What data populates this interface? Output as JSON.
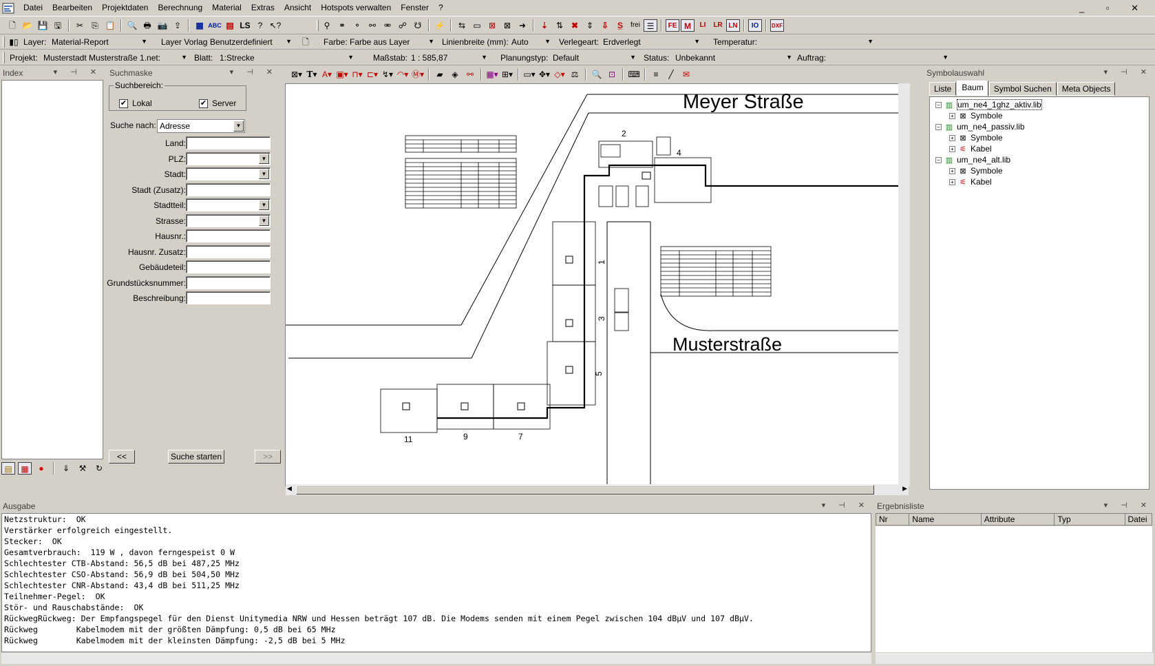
{
  "menu": [
    "Datei",
    "Bearbeiten",
    "Projektdaten",
    "Berechnung",
    "Material",
    "Extras",
    "Ansicht",
    "Hotspots verwalten",
    "Fenster",
    "?"
  ],
  "toolbar1": {
    "icons_left": [
      "new-icon",
      "open-icon",
      "save-icon",
      "save-all-icon",
      "cut-icon",
      "copy-icon",
      "paste-icon",
      "print-preview-icon",
      "print-icon",
      "camera-icon",
      "export-icon",
      "check-icon",
      "abc-icon",
      "check-network-icon",
      "ls-icon",
      "help-icon",
      "pointer-help-icon"
    ],
    "text_freq": "frei"
  },
  "toolbar2": {
    "layer_label": "Layer:",
    "layer_value": "Material-Report",
    "vorlage_label": "Layer Vorlage:",
    "vorlage_value": "Benutzerdefiniert",
    "farbe_label": "Farbe:",
    "farbe_value": "Farbe aus Layer",
    "linienbreite_label": "Linienbreite (mm):",
    "linienbreite_value": "Auto",
    "verlegeart_label": "Verlegeart:",
    "verlegeart_value": "Erdverlegt",
    "temperatur_label": "Temperatur:",
    "temperatur_value": ""
  },
  "toolbar3": {
    "projekt_label": "Projekt:",
    "projekt_value": "Musterstadt Musterstraße 1.net:",
    "blatt_label": "Blatt:",
    "blatt_value": "1:Strecke",
    "massstab_label": "Maßstab:",
    "massstab_value": "1 : 585,87",
    "planungstyp_label": "Planungstyp:",
    "planungstyp_value": "Default",
    "status_label": "Status:",
    "status_value": "Unbekannt",
    "auftrag_label": "Auftrag:",
    "auftrag_value": ""
  },
  "index": {
    "title": "Index"
  },
  "suchmaske": {
    "title": "Suchmaske",
    "suchbereich": "Suchbereich:",
    "lokal": "Lokal",
    "server": "Server",
    "suche_nach_label": "Suche nach:",
    "suche_nach_value": "Adresse",
    "fields": [
      {
        "label": "Land:",
        "combo": false
      },
      {
        "label": "PLZ:",
        "combo": true
      },
      {
        "label": "Stadt:",
        "combo": true
      },
      {
        "label": "Stadt (Zusatz):",
        "combo": false
      },
      {
        "label": "Stadtteil:",
        "combo": true
      },
      {
        "label": "Strasse:",
        "combo": true
      },
      {
        "label": "Hausnr.:",
        "combo": false
      },
      {
        "label": "Hausnr. Zusatz:",
        "combo": false
      },
      {
        "label": "Gebäudeteil:",
        "combo": false
      },
      {
        "label": "Grundstücksnummer:",
        "combo": false
      },
      {
        "label": "Beschreibung:",
        "combo": false
      }
    ],
    "prev": "<<",
    "start": "Suche starten",
    "next": ">>"
  },
  "drawing": {
    "street1": "Meyer Straße",
    "street2": "Musterstraße",
    "house_numbers": [
      "2",
      "4",
      "1",
      "3",
      "5",
      "11",
      "9",
      "7"
    ]
  },
  "symbolauswahl": {
    "title": "Symbolauswahl",
    "tabs": [
      "Liste",
      "Baum",
      "Symbol Suchen",
      "Meta Objects"
    ],
    "active_tab": "Baum",
    "tree": [
      {
        "label": "um_ne4_1ghz_aktiv.lib",
        "level": 0
      },
      {
        "label": "Symbole",
        "level": 1
      },
      {
        "label": "um_ne4_passiv.lib",
        "level": 0
      },
      {
        "label": "Symbole",
        "level": 1
      },
      {
        "label": "Kabel",
        "level": 1
      },
      {
        "label": "um_ne4_alt.lib",
        "level": 0
      },
      {
        "label": "Symbole",
        "level": 1
      },
      {
        "label": "Kabel",
        "level": 1
      }
    ]
  },
  "ausgabe": {
    "title": "Ausgabe",
    "lines": [
      "Netzstruktur:  OK",
      "Verstärker erfolgreich eingestellt.",
      "Stecker:  OK",
      "Gesamtverbrauch:  119 W , davon ferngespeist 0 W",
      "Schlechtester CTB-Abstand: 56,5 dB bei 487,25 MHz",
      "Schlechtester CSO-Abstand: 56,9 dB bei 504,50 MHz",
      "Schlechtester CNR-Abstand: 43,4 dB bei 511,25 MHz",
      "Teilnehmer-Pegel:  OK",
      "Stör- und Rauschabstände:  OK",
      "RückwegRückweg: Der Empfangspegel für den Dienst Unitymedia NRW und Hessen beträgt 107 dB. Die Modems senden mit einem Pegel zwischen 104 dBµV und 107 dBµV.",
      "Rückweg        Kabelmodem mit der größten Dämpfung: 0,5 dB bei 65 MHz",
      "Rückweg        Kabelmodem mit der kleinsten Dämpfung: -2,5 dB bei 5 MHz"
    ]
  },
  "ergebnis": {
    "title": "Ergebnisliste",
    "columns": [
      "Nr",
      "Name",
      "Attribute",
      "Typ",
      "Datei"
    ]
  }
}
